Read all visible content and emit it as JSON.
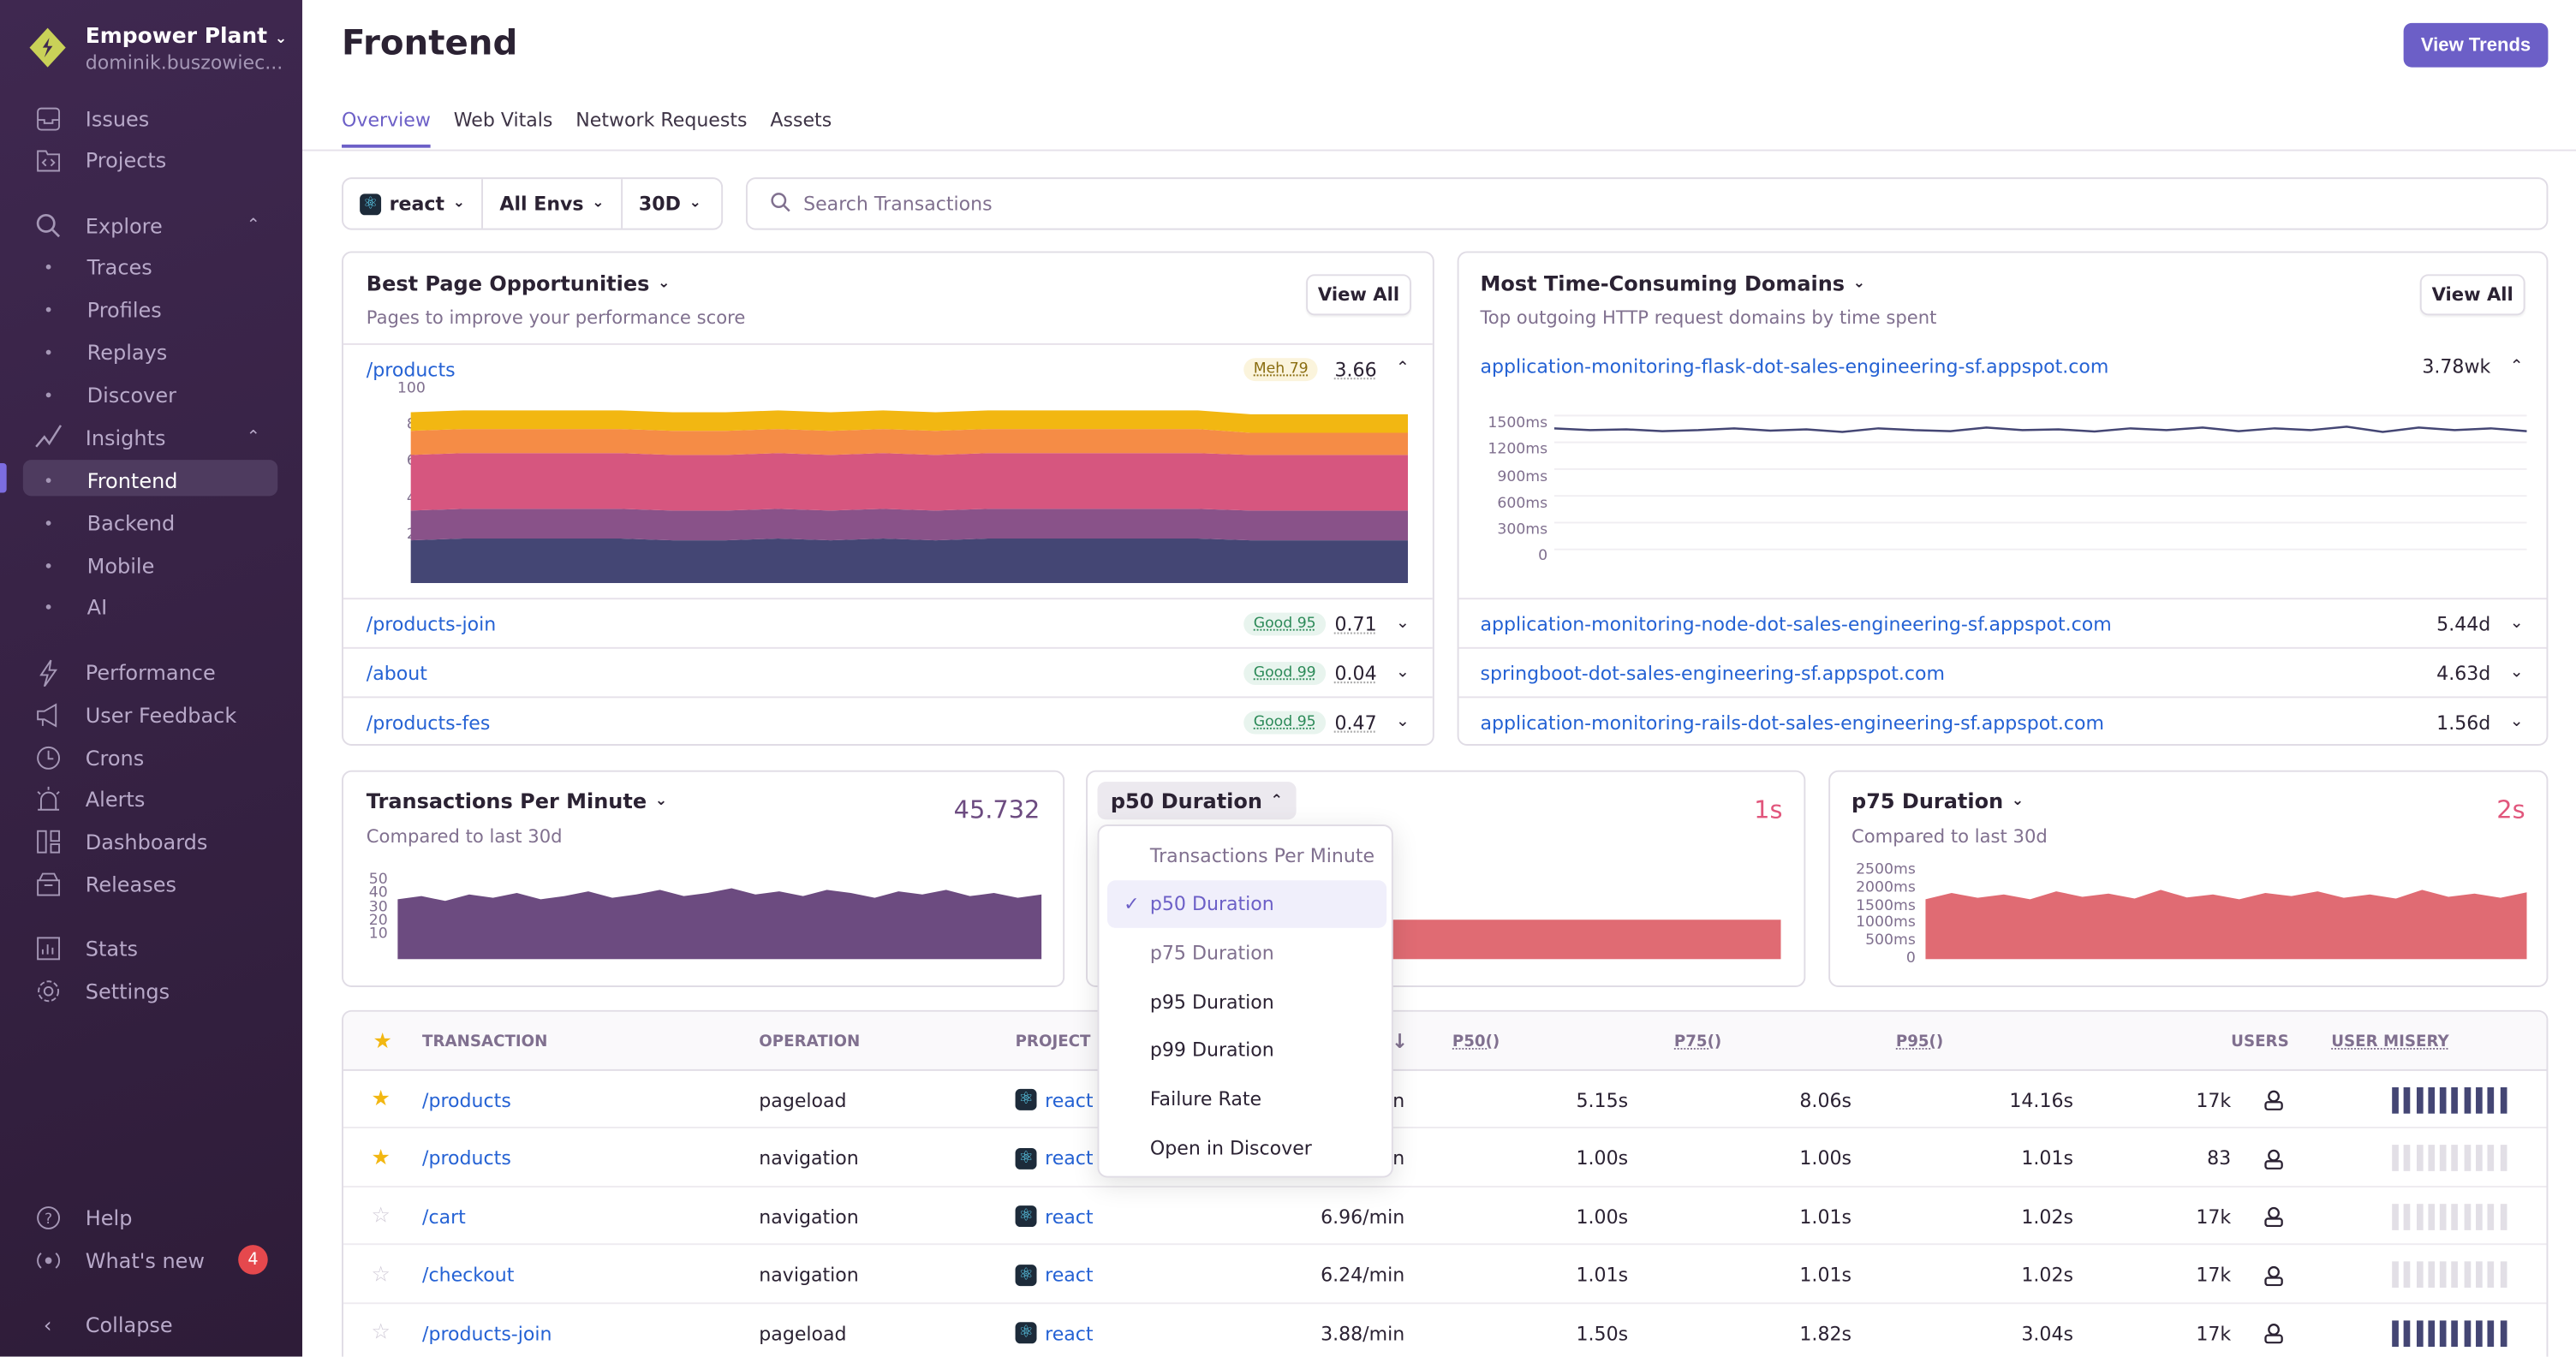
{
  "org": {
    "name": "Empower Plant",
    "user": "dominik.buszowiec..."
  },
  "sidebar": {
    "items": [
      {
        "label": "Issues",
        "icon": "inbox-icon"
      },
      {
        "label": "Projects",
        "icon": "folder-code-icon"
      },
      {
        "label": "Explore",
        "icon": "search-icon",
        "expanded": true
      },
      {
        "label": "Traces",
        "sub": true
      },
      {
        "label": "Profiles",
        "sub": true
      },
      {
        "label": "Replays",
        "sub": true
      },
      {
        "label": "Discover",
        "sub": true
      },
      {
        "label": "Insights",
        "icon": "graph-icon",
        "expanded": true
      },
      {
        "label": "Frontend",
        "sub": true,
        "active": true
      },
      {
        "label": "Backend",
        "sub": true
      },
      {
        "label": "Mobile",
        "sub": true
      },
      {
        "label": "AI",
        "sub": true
      },
      {
        "label": "Performance",
        "icon": "lightning-icon"
      },
      {
        "label": "User Feedback",
        "icon": "megaphone-icon"
      },
      {
        "label": "Crons",
        "icon": "clock-icon"
      },
      {
        "label": "Alerts",
        "icon": "siren-icon"
      },
      {
        "label": "Dashboards",
        "icon": "dashboard-icon"
      },
      {
        "label": "Releases",
        "icon": "package-icon"
      },
      {
        "label": "Stats",
        "icon": "stats-icon"
      },
      {
        "label": "Settings",
        "icon": "gear-icon"
      }
    ],
    "help": "Help",
    "whats_new": "What's new",
    "whats_new_count": "4",
    "collapse": "Collapse"
  },
  "header": {
    "title": "Frontend",
    "view_trends": "View Trends"
  },
  "tabs": [
    {
      "label": "Overview",
      "active": true
    },
    {
      "label": "Web Vitals"
    },
    {
      "label": "Network Requests"
    },
    {
      "label": "Assets"
    }
  ],
  "filters": {
    "project": "react",
    "env": "All Envs",
    "period": "30D",
    "search_placeholder": "Search Transactions"
  },
  "opportunities": {
    "title": "Best Page Opportunities",
    "subtitle": "Pages to improve your performance score",
    "view_all": "View All",
    "rows": [
      {
        "page": "/products",
        "badge": "Meh 79",
        "status": "meh",
        "value": "3.66",
        "expanded": true
      },
      {
        "page": "/products-join",
        "badge": "Good 95",
        "status": "good",
        "value": "0.71"
      },
      {
        "page": "/about",
        "badge": "Good 99",
        "status": "good",
        "value": "0.04"
      },
      {
        "page": "/products-fes",
        "badge": "Good 95",
        "status": "good",
        "value": "0.47"
      }
    ]
  },
  "domains": {
    "title": "Most Time-Consuming Domains",
    "subtitle": "Top outgoing HTTP request domains by time spent",
    "view_all": "View All",
    "rows": [
      {
        "domain": "application-monitoring-flask-dot-sales-engineering-sf.appspot.com",
        "value": "3.78wk",
        "expanded": true
      },
      {
        "domain": "application-monitoring-node-dot-sales-engineering-sf.appspot.com",
        "value": "5.44d"
      },
      {
        "domain": "springboot-dot-sales-engineering-sf.appspot.com",
        "value": "4.63d"
      },
      {
        "domain": "application-monitoring-rails-dot-sales-engineering-sf.appspot.com",
        "value": "1.56d"
      }
    ]
  },
  "widgets": [
    {
      "title": "Transactions Per Minute",
      "subtitle": "Compared to last 30d",
      "value": "45.732"
    },
    {
      "title": "p50 Duration",
      "value": "1s"
    },
    {
      "title": "p75 Duration",
      "subtitle": "Compared to last 30d",
      "value": "2s"
    }
  ],
  "dropdown": {
    "items": [
      {
        "label": "Transactions Per Minute",
        "disabled": true
      },
      {
        "label": "p50 Duration",
        "selected": true
      },
      {
        "label": "p75 Duration",
        "disabled": true
      },
      {
        "label": "p95 Duration"
      },
      {
        "label": "p99 Duration"
      },
      {
        "label": "Failure Rate"
      },
      {
        "label": "Open in Discover"
      }
    ]
  },
  "table": {
    "columns": [
      "TRANSACTION",
      "OPERATION",
      "PROJECT",
      "P50()",
      "P75()",
      "P95()",
      "USERS",
      "USER MISERY"
    ],
    "rows": [
      {
        "starred": true,
        "transaction": "/products",
        "operation": "pageload",
        "project": "react",
        "tpm": "in",
        "p50": "5.15s",
        "p75": "8.06s",
        "p95": "14.16s",
        "users": "17k",
        "misery": "high"
      },
      {
        "starred": true,
        "transaction": "/products",
        "operation": "navigation",
        "project": "react",
        "tpm": "in",
        "p50": "1.00s",
        "p75": "1.00s",
        "p95": "1.01s",
        "users": "83",
        "misery": "none"
      },
      {
        "starred": false,
        "transaction": "/cart",
        "operation": "navigation",
        "project": "react",
        "tpm": "6.96/min",
        "p50": "1.00s",
        "p75": "1.01s",
        "p95": "1.02s",
        "users": "17k",
        "misery": "none"
      },
      {
        "starred": false,
        "transaction": "/checkout",
        "operation": "navigation",
        "project": "react",
        "tpm": "6.24/min",
        "p50": "1.01s",
        "p75": "1.01s",
        "p95": "1.02s",
        "users": "17k",
        "misery": "none"
      },
      {
        "starred": false,
        "transaction": "/products-join",
        "operation": "pageload",
        "project": "react",
        "tpm": "3.88/min",
        "p50": "1.50s",
        "p75": "1.82s",
        "p95": "3.04s",
        "users": "17k",
        "misery": "high"
      }
    ]
  },
  "colors": {
    "accent": "#6c5fc7",
    "link": "#2562d4",
    "sidebar": "#3f2850",
    "red": "#e1567c",
    "misery": "#444674"
  },
  "chart_data": [
    {
      "type": "area",
      "stacked": true,
      "ylim": [
        0,
        100
      ],
      "yticks": [
        "100",
        "80",
        "60",
        "40",
        "20",
        "0"
      ],
      "series": [
        {
          "color": "#444674",
          "values": [
            23,
            24,
            24,
            24,
            24,
            23,
            23,
            24,
            23,
            24,
            23,
            24,
            24,
            24,
            24,
            24,
            23,
            23,
            23,
            23
          ]
        },
        {
          "color": "#895289",
          "values": [
            16,
            16,
            16,
            16,
            16,
            16,
            16,
            16,
            16,
            16,
            16,
            16,
            16,
            16,
            16,
            16,
            16,
            16,
            16,
            16
          ]
        },
        {
          "color": "#d6567f",
          "values": [
            30,
            30,
            30,
            30,
            30,
            30,
            30,
            30,
            30,
            30,
            30,
            30,
            30,
            30,
            30,
            30,
            30,
            30,
            30,
            30
          ]
        },
        {
          "color": "#f58c46",
          "values": [
            13,
            13,
            13,
            13,
            13,
            13,
            13,
            13,
            13,
            13,
            13,
            13,
            13,
            13,
            13,
            13,
            12,
            12,
            12,
            12
          ]
        },
        {
          "color": "#f2b712",
          "values": [
            10,
            10,
            10,
            10,
            10,
            10,
            10,
            10,
            10,
            10,
            10,
            10,
            10,
            10,
            10,
            10,
            10,
            10,
            10,
            10
          ]
        }
      ]
    },
    {
      "type": "line",
      "ylim": [
        0,
        1500
      ],
      "yticks": [
        "1500ms",
        "1200ms",
        "900ms",
        "600ms",
        "300ms",
        "0"
      ],
      "color": "#444674",
      "values": [
        1420,
        1400,
        1410,
        1390,
        1400,
        1420,
        1395,
        1410,
        1380,
        1420,
        1400,
        1390,
        1430,
        1400,
        1410,
        1385,
        1420,
        1400,
        1430,
        1390,
        1420,
        1400,
        1440,
        1380,
        1430,
        1400,
        1420,
        1390
      ]
    },
    {
      "type": "area",
      "ylim": [
        0,
        50
      ],
      "yticks": [
        "50",
        "40",
        "30",
        "20",
        "10"
      ],
      "color": "#6c4b80",
      "values": [
        38,
        40,
        37,
        41,
        39,
        42,
        38,
        40,
        43,
        39,
        41,
        44,
        40,
        42,
        45,
        41,
        43,
        40,
        44,
        42,
        39,
        43,
        41,
        44,
        40,
        42,
        39,
        41
      ]
    },
    {
      "type": "area",
      "ylim": [
        0,
        2000
      ],
      "color": "#e06b73",
      "values": [
        1000,
        1000,
        1000,
        1000,
        1000,
        1000,
        1000,
        1000,
        1000,
        1000,
        1000,
        1000,
        1000,
        1000,
        1000,
        1000,
        1000,
        1000,
        1000,
        1000
      ]
    },
    {
      "type": "area",
      "ylim": [
        0,
        2500
      ],
      "yticks": [
        "2500ms",
        "2000ms",
        "1500ms",
        "1000ms",
        "500ms",
        "0"
      ],
      "color": "#e06b73",
      "values": [
        1900,
        2100,
        1950,
        2050,
        1900,
        2150,
        1980,
        2080,
        1920,
        2200,
        1960,
        2050,
        1900,
        2100,
        2000,
        2150,
        1950,
        2050,
        1920,
        2200,
        1980,
        2080,
        1950,
        2120
      ]
    }
  ]
}
